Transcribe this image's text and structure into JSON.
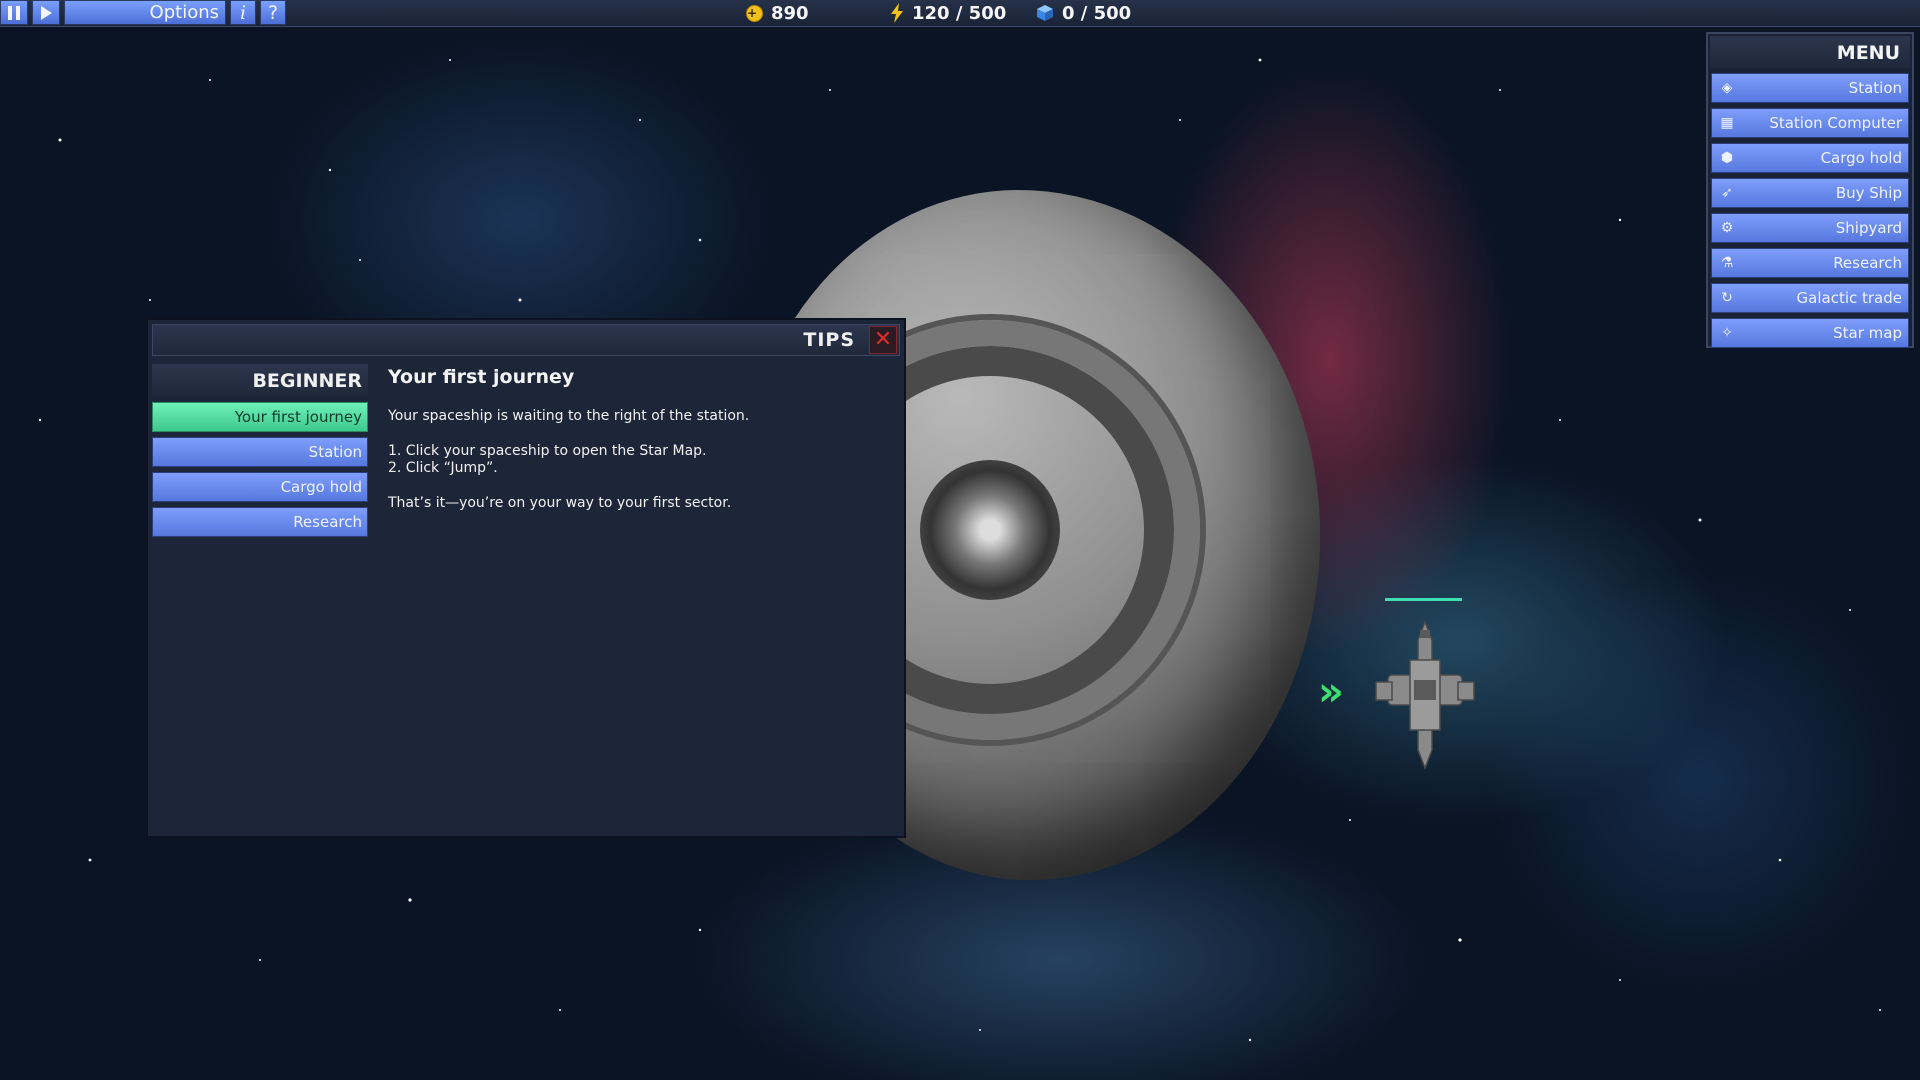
{
  "topbar": {
    "options_label": "Options",
    "pause_icon": "pause-icon",
    "play_icon": "play-icon",
    "info_label": "i",
    "help_label": "?",
    "credits": "890",
    "energy": "120 / 500",
    "cargo": "0 / 500",
    "colors": {
      "button": "#6b8cf0",
      "credit": "#f2c21a",
      "energy": "#f2c21a",
      "cargo": "#4aa0ff"
    }
  },
  "menu": {
    "title": "MENU",
    "items": [
      {
        "label": "Station",
        "icon": "station-icon"
      },
      {
        "label": "Station Computer",
        "icon": "computer-icon"
      },
      {
        "label": "Cargo hold",
        "icon": "cube-icon"
      },
      {
        "label": "Buy Ship",
        "icon": "rocket-icon"
      },
      {
        "label": "Shipyard",
        "icon": "gear-icon"
      },
      {
        "label": "Research",
        "icon": "flask-icon"
      },
      {
        "label": "Galactic trade",
        "icon": "refresh-icon"
      },
      {
        "label": "Star map",
        "icon": "star-map-icon"
      }
    ]
  },
  "tips": {
    "title": "TIPS",
    "close_label": "✕",
    "category": "BEGINNER",
    "items": [
      {
        "label": "Your first journey",
        "active": true
      },
      {
        "label": "Station",
        "active": false
      },
      {
        "label": "Cargo hold",
        "active": false
      },
      {
        "label": "Research",
        "active": false
      }
    ],
    "heading": "Your first journey",
    "body": [
      "Your spaceship is waiting to the right of the station.",
      "1. Click your spaceship to open the Star Map.",
      "2. Click “Jump”.",
      "That’s it—you’re on your way to your first sector."
    ],
    "active_color": "#4fdc9e"
  }
}
